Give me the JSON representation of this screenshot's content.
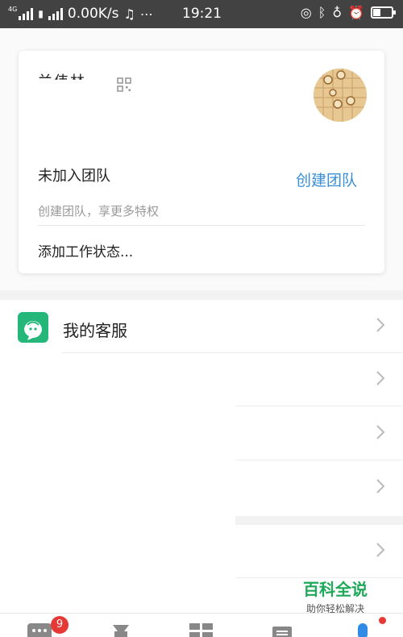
{
  "status_bar": {
    "network": "4G",
    "speed": "0.00K/s",
    "time": "19:21",
    "icons": [
      "signal-icon",
      "sim-icon",
      "music-note-icon",
      "more-dots-icon",
      "location-icon",
      "bluetooth-icon",
      "headset-icon",
      "alarm-icon",
      "battery-icon"
    ]
  },
  "profile_card": {
    "user_name": "兰伟林",
    "team_status": "未加入团队",
    "create_team_link": "创建团队",
    "team_hint": "创建团队，享更多特权",
    "work_status": "添加工作状态..."
  },
  "menu": {
    "items": [
      {
        "label": "我的客服",
        "icon": "customer-service-icon"
      },
      {
        "label": ""
      },
      {
        "label": ""
      },
      {
        "label": ""
      },
      {
        "label": ""
      }
    ]
  },
  "watermark": {
    "title": "百科全说",
    "subtitle": "助你轻松解决"
  },
  "bottom_nav": {
    "tabs": [
      "messages-tab-icon",
      "ding-tab-icon",
      "workbench-tab-icon",
      "contacts-tab-icon",
      "me-tab-icon"
    ],
    "message_badge": "9"
  },
  "colors": {
    "accent_blue": "#3a8ed8",
    "service_green": "#25b77a",
    "badge_red": "#e53935",
    "status_bar": "#424242"
  }
}
